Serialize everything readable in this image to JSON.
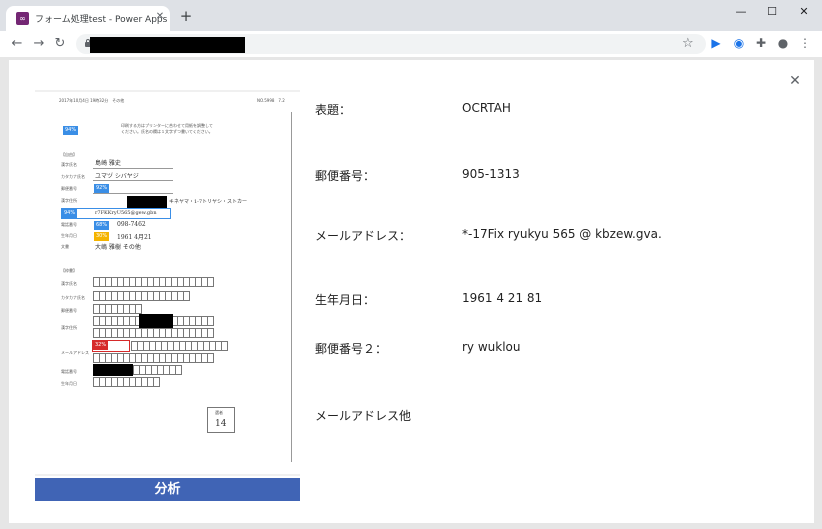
{
  "browser": {
    "tab_title": "フォーム処理test - Power Apps",
    "tab_close_glyph": "✕",
    "new_tab_glyph": "+",
    "favicon_text": "∞",
    "window_buttons": [
      "—",
      "☐",
      "✕"
    ]
  },
  "toolbar": {
    "back_glyph": "←",
    "forward_glyph": "→",
    "reload_glyph": "↻",
    "star_glyph": "☆",
    "extension_glyphs": [
      "▶",
      "◉",
      "✚",
      "●",
      "⋮"
    ]
  },
  "dialog": {
    "close_glyph": "✕",
    "analyze_button_label": "分析"
  },
  "fields": [
    {
      "label": "表題：",
      "value": "OCRTAH"
    },
    {
      "label": "郵便番号：",
      "value": "905-1313"
    },
    {
      "label": "メールアドレス：",
      "value": "*-17Fix ryukyu 565 @ kbzew.gva."
    },
    {
      "label": "生年月日：",
      "value": "1961 4 21 81"
    },
    {
      "label": "郵便番号２：",
      "value": "ry wuklou"
    },
    {
      "label": "メールアドレス他",
      "value": ""
    }
  ],
  "form_image": {
    "header_left": "2017年10月4日 19時32分　その他",
    "header_right": "NO.5998　7.2",
    "badge_title": "94%",
    "title_note": "印刷する方はプリンターに合わせて用紙を調整して",
    "title_note2": "ください。氏名の欄は１文字ずつ書いてください。",
    "section_1": "【自由】",
    "section_2": "【枠書】",
    "labels_1": [
      "漢字氏名",
      "カタカナ氏名",
      "郵便番号",
      "漢字住所",
      "電話番号",
      "生年月日",
      "文書"
    ],
    "labels_2": [
      "漢字氏名",
      "カタカナ氏名",
      "郵便番号",
      "漢字住所",
      "メールアドレス",
      "電話番号",
      "生年月日"
    ],
    "hand_name": "島崎 雅史",
    "hand_kana": "ユマヅ シバヤジ",
    "hand_address_tail": "キネヤマ・1-7トリヤシ・ストカー",
    "hand_email": "r7FKKryU565@gew.gbn",
    "hand_phone": "098-7462",
    "hand_birth": "1961 4月21",
    "hand_doc": "大嶋 雅樹 その他",
    "badge_zip": "92%",
    "badge_address": "94%",
    "badge_phone": "68%",
    "badge_birth": "30%",
    "badge_email": "32%",
    "stamp_label": "選者",
    "stamp_value": "14"
  }
}
